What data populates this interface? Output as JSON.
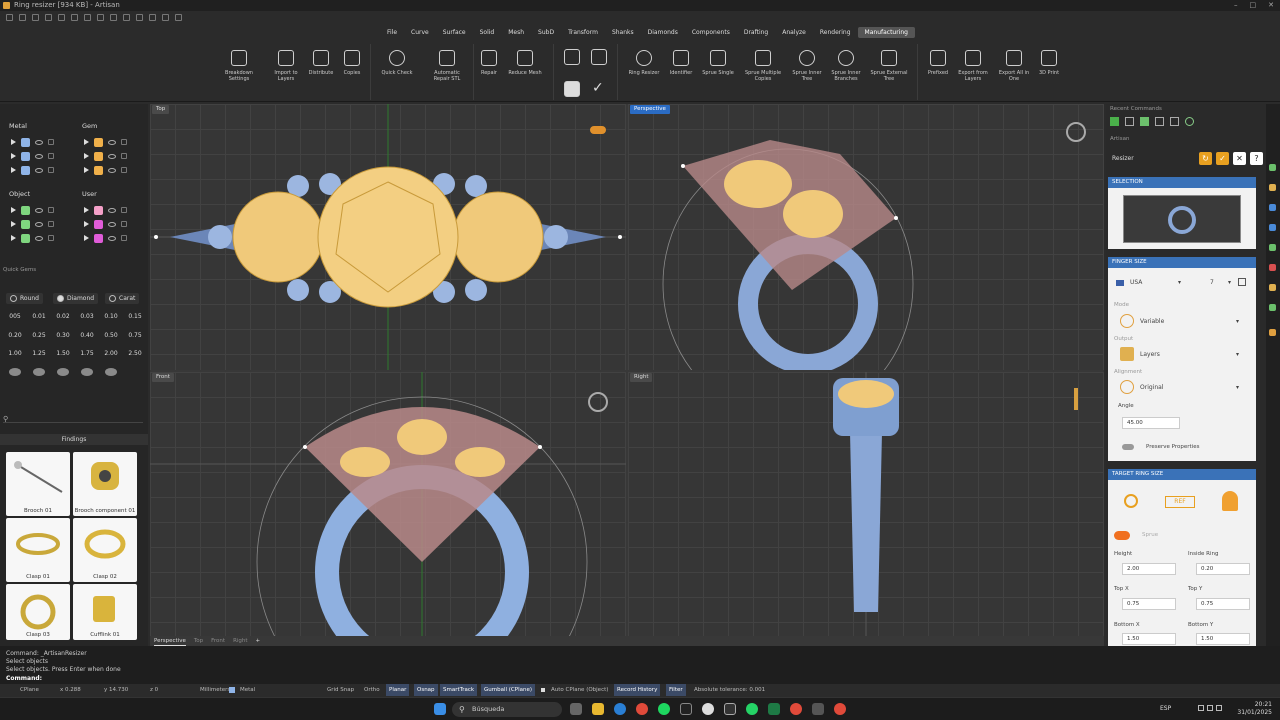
{
  "window": {
    "title": "Ring resizer [934 KB] - Artisan"
  },
  "menu": [
    "File",
    "Curve",
    "Surface",
    "Solid",
    "Mesh",
    "SubD",
    "Transform",
    "Shanks",
    "Diamonds",
    "Components",
    "Drafting",
    "Analyze",
    "Rendering",
    "Manufacturing"
  ],
  "ribbon": {
    "breakdown": "Breakdown Settings",
    "import_layers": "Import to Layers",
    "distribute": "Distribute",
    "copies": "Copies",
    "quick_check": "Quick Check",
    "auto_repair": "Automatic Repair STL",
    "repair": "Repair",
    "reduce_mesh": "Reduce Mesh",
    "ring_resizer": "Ring Resizer",
    "identifier": "Identifier",
    "sprue_single": "Sprue Single",
    "sprue_multiple": "Sprue Multiple Copies",
    "sprue_inner_tree": "Sprue Inner Tree",
    "sprue_inner_branches": "Sprue Inner Branches",
    "sprue_external_tree": "Sprue External Tree",
    "prefixed": "Prefixed",
    "export_from_layers": "Export from Layers",
    "export_all": "Export All in One",
    "print_3d": "3D Print"
  },
  "layers": {
    "metal_title": "Metal",
    "gem_title": "Gem",
    "object_title": "Object",
    "user_title": "User",
    "metal_colors": [
      "#8fb4e8",
      "#8fb4e8",
      "#8fb4e8"
    ],
    "gem_colors": [
      "#f0b04a",
      "#f0b04a",
      "#f0b04a"
    ],
    "object_colors": [
      "#7fd67f",
      "#7fd67f",
      "#7fd67f"
    ],
    "user_colors": [
      "#f4a0c8",
      "#e05cd8",
      "#e05cd8"
    ]
  },
  "quick_gems": {
    "title": "Quick Gems",
    "round": "Round",
    "diamond": "Diamond",
    "carat": "Carat",
    "sizes": [
      "005",
      "0.01",
      "0.02",
      "0.03",
      "0.10",
      "0.15",
      "0.20",
      "0.25",
      "0.30",
      "0.40",
      "0.50",
      "0.75",
      "1.00",
      "1.25",
      "1.50",
      "1.75",
      "2.00",
      "2.50"
    ]
  },
  "findings": {
    "title": "Findings",
    "items": [
      "Brooch 01",
      "Brooch component 01",
      "Clasp 01",
      "Clasp 02",
      "Clasp 03",
      "Cufflink 01"
    ]
  },
  "viewports": {
    "top": "Top",
    "perspective": "Perspective",
    "front": "Front",
    "right": "Right"
  },
  "viewport_tabs": [
    "Perspective",
    "Top",
    "Front",
    "Right"
  ],
  "recent_commands": "Recent Commands",
  "resizer": {
    "panel": "Artisan",
    "title": "Resizer",
    "selection": "SELECTION",
    "finger_size": "FINGER SIZE",
    "country": "USA",
    "size": "7",
    "mode_label": "Mode",
    "mode": "Variable",
    "output_label": "Output",
    "output": "Layers",
    "alignment_label": "Alignment",
    "alignment": "Original",
    "angle_label": "Angle",
    "angle": "45.00",
    "preserve": "Preserve Properties",
    "target": "TARGET RING SIZE",
    "ref": "REF",
    "sprue": "Sprue",
    "height_label": "Height",
    "height": "2.00",
    "inside_label": "Inside Ring",
    "inside": "0.20",
    "topx_label": "Top X",
    "topx": "0.75",
    "topy_label": "Top Y",
    "topy": "0.75",
    "botx_label": "Bottom X",
    "botx": "1.50",
    "boty_label": "Bottom Y",
    "boty": "1.50"
  },
  "command": {
    "line1": "Command: _ArtisanResizer",
    "line2": "Select objects",
    "line3": "Select objects. Press Enter when done",
    "prompt": "Command:"
  },
  "status": {
    "cplane": "CPlane",
    "x": "x 0.288",
    "y": "y 14.730",
    "z": "z 0",
    "units": "Millimeters",
    "layer": "Metal",
    "grid_snap": "Grid Snap",
    "ortho": "Ortho",
    "planar": "Planar",
    "osnap": "Osnap",
    "smarttrack": "SmartTrack",
    "gumball": "Gumball (CPlane)",
    "autocplane": "Auto CPlane (Object)",
    "record": "Record History",
    "filter": "Filter",
    "tolerance": "Absolute tolerance: 0.001"
  },
  "taskbar": {
    "search": "Búsqueda",
    "lang": "ESP",
    "time": "20:21",
    "date": "31/01/2025"
  }
}
